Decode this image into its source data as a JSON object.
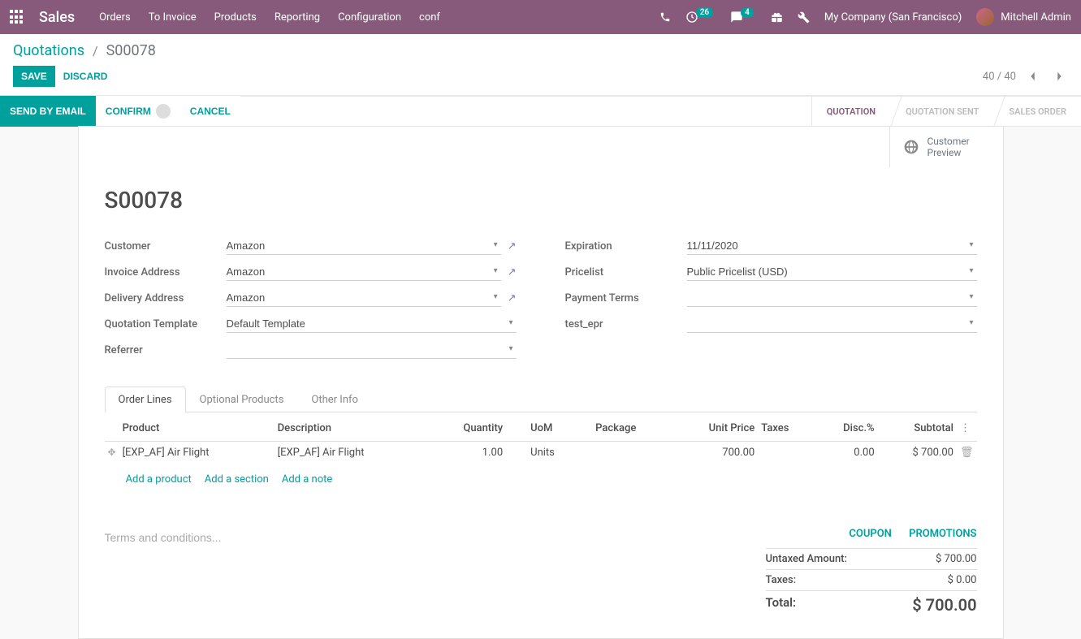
{
  "topnav": {
    "brand": "Sales",
    "menus": [
      "Orders",
      "To Invoice",
      "Products",
      "Reporting",
      "Configuration",
      "conf"
    ],
    "activity_badge": "26",
    "message_badge": "4",
    "company": "My Company (San Francisco)",
    "user": "Mitchell Admin"
  },
  "breadcrumb": {
    "root": "Quotations",
    "current": "S00078"
  },
  "buttons": {
    "save": "SAVE",
    "discard": "DISCARD",
    "send_email": "SEND BY EMAIL",
    "confirm": "CONFIRM",
    "cancel": "CANCEL"
  },
  "pager": {
    "current": "40",
    "total": "40"
  },
  "stages": [
    "QUOTATION",
    "QUOTATION SENT",
    "SALES ORDER"
  ],
  "stat_button": {
    "line1": "Customer",
    "line2": "Preview"
  },
  "record": {
    "name": "S00078"
  },
  "fields": {
    "customer_label": "Customer",
    "customer_value": "Amazon",
    "invoice_label": "Invoice Address",
    "invoice_value": "Amazon",
    "delivery_label": "Delivery Address",
    "delivery_value": "Amazon",
    "template_label": "Quotation Template",
    "template_value": "Default Template",
    "referrer_label": "Referrer",
    "referrer_value": "",
    "expiration_label": "Expiration",
    "expiration_value": "11/11/2020",
    "pricelist_label": "Pricelist",
    "pricelist_value": "Public Pricelist (USD)",
    "payment_label": "Payment Terms",
    "payment_value": "",
    "testepr_label": "test_epr",
    "testepr_value": ""
  },
  "tabs": [
    "Order Lines",
    "Optional Products",
    "Other Info"
  ],
  "table": {
    "headers": {
      "product": "Product",
      "description": "Description",
      "quantity": "Quantity",
      "uom": "UoM",
      "package": "Package",
      "unit_price": "Unit Price",
      "taxes": "Taxes",
      "disc": "Disc.%",
      "subtotal": "Subtotal"
    },
    "rows": [
      {
        "product": "[EXP_AF] Air Flight",
        "description": "[EXP_AF] Air Flight",
        "quantity": "1.00",
        "uom": "Units",
        "package": "",
        "unit_price": "700.00",
        "taxes": "",
        "disc": "0.00",
        "subtotal": "$ 700.00"
      }
    ],
    "add_product": "Add a product",
    "add_section": "Add a section",
    "add_note": "Add a note"
  },
  "terms_placeholder": "Terms and conditions...",
  "promos": {
    "coupon": "COUPON",
    "promotions": "PROMOTIONS"
  },
  "totals": {
    "untaxed_label": "Untaxed Amount:",
    "untaxed_val": "$ 700.00",
    "taxes_label": "Taxes:",
    "taxes_val": "$ 0.00",
    "total_label": "Total:",
    "total_val": "$ 700.00"
  }
}
